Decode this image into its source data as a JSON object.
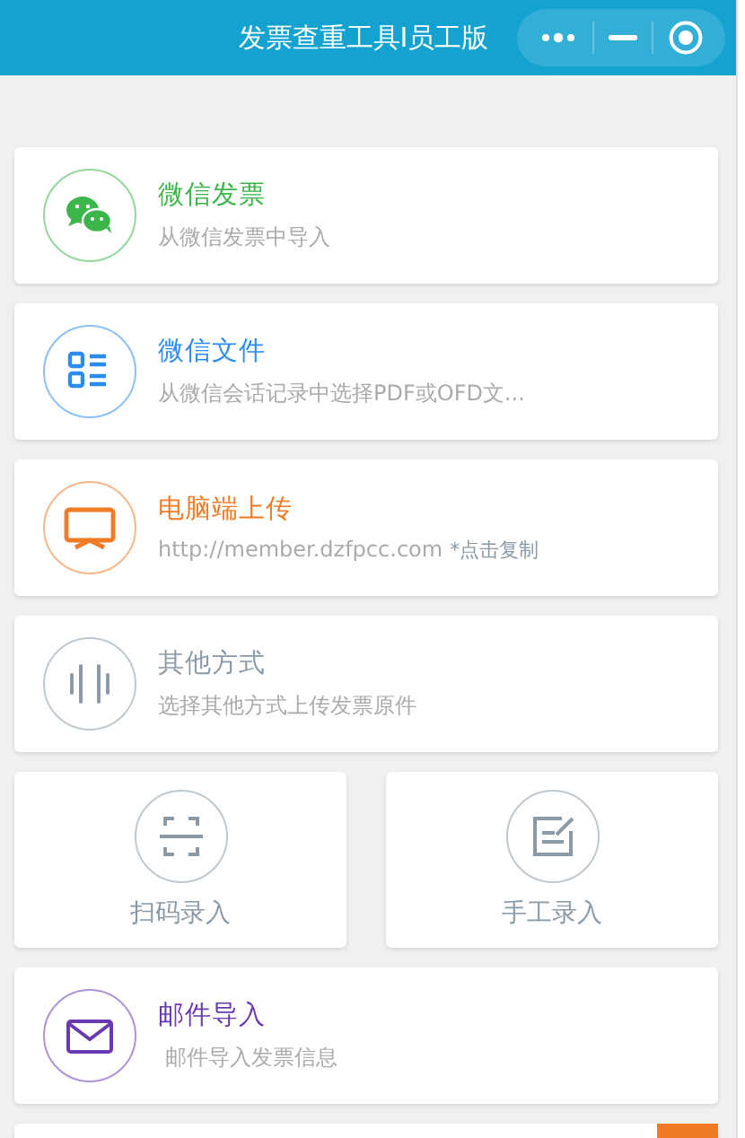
{
  "header": {
    "title": "发票查重工具I员工版"
  },
  "options": [
    {
      "kind": "row",
      "title": "微信发票",
      "subtitle": "从微信发票中导入",
      "color": "#3cb64a"
    },
    {
      "kind": "row",
      "title": "微信文件",
      "subtitle": "从微信会话记录中选择PDF或OFD文...",
      "color": "#2b8cf0"
    },
    {
      "kind": "row",
      "title": "电脑端上传",
      "subtitle": "http://member.dzfpcc.com",
      "note": "*点击复制",
      "color": "#f07b24"
    },
    {
      "kind": "row",
      "title": "其他方式",
      "subtitle": "选择其他方式上传发票原件",
      "color": "#8a9aa6"
    },
    {
      "kind": "tile",
      "title": "扫码录入",
      "color": "#8a9aa6"
    },
    {
      "kind": "tile",
      "title": "手工录入",
      "color": "#8a9aa6"
    },
    {
      "kind": "row",
      "title": "邮件导入",
      "subtitle": " 邮件导入发票信息",
      "color": "#6a3ab2"
    }
  ]
}
